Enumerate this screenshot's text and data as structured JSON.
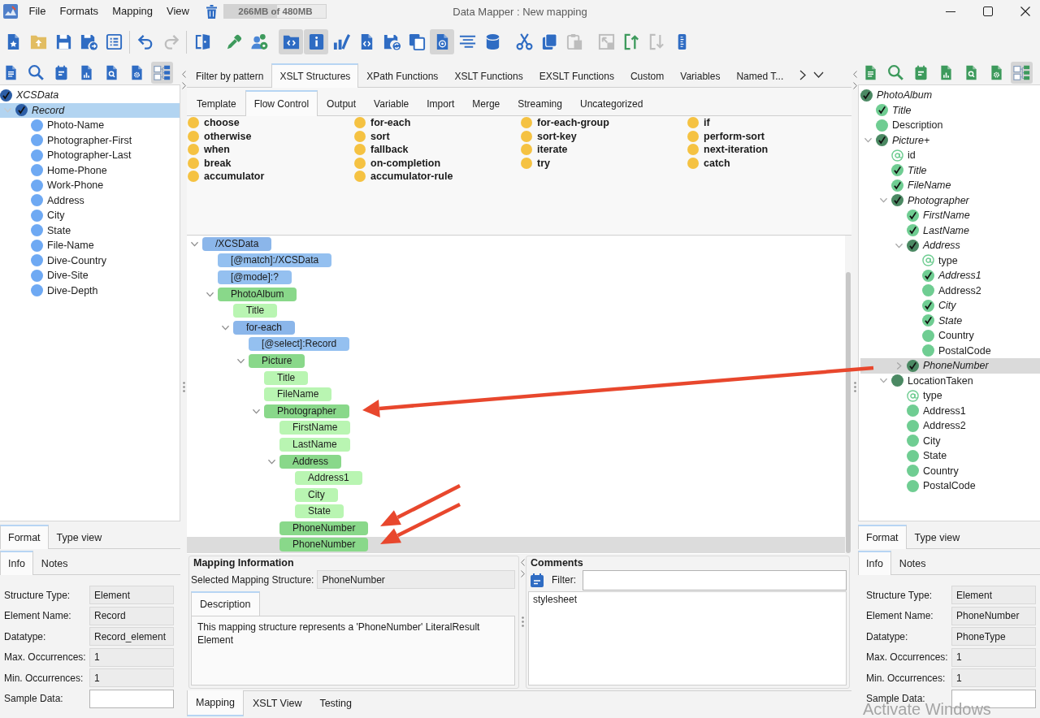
{
  "window": {
    "title": "Data Mapper : New mapping"
  },
  "menu": [
    "File",
    "Formats",
    "Mapping",
    "View"
  ],
  "memory": {
    "text": "266MB of 480MB",
    "level": 0.52
  },
  "toolbar": {
    "groups": [
      [
        {
          "pressed": false,
          "disabled": false
        },
        {
          "pressed": false,
          "disabled": false
        },
        {
          "pressed": false,
          "disabled": false
        },
        {
          "pressed": false,
          "disabled": false
        },
        {
          "pressed": false,
          "disabled": false
        }
      ],
      [
        {
          "pressed": false,
          "disabled": false
        },
        {
          "pressed": false,
          "disabled": true
        }
      ],
      [
        {
          "pressed": false,
          "disabled": false
        }
      ],
      [
        {
          "pressed": false,
          "disabled": false
        },
        {
          "pressed": false,
          "disabled": false
        }
      ],
      [
        {
          "pressed": true,
          "disabled": false
        },
        {
          "pressed": true,
          "disabled": false
        },
        {
          "pressed": false,
          "disabled": false
        },
        {
          "pressed": false,
          "disabled": false
        },
        {
          "pressed": false,
          "disabled": false
        },
        {
          "pressed": false,
          "disabled": false
        },
        {
          "pressed": true,
          "disabled": false
        },
        {
          "pressed": false,
          "disabled": false
        },
        {
          "pressed": false,
          "disabled": false
        }
      ],
      [
        {
          "pressed": false,
          "disabled": false
        },
        {
          "pressed": false,
          "disabled": false
        },
        {
          "pressed": false,
          "disabled": true
        }
      ],
      [
        {
          "pressed": false,
          "disabled": true
        },
        {
          "pressed": false,
          "disabled": false
        },
        {
          "pressed": false,
          "disabled": true
        },
        {
          "pressed": false,
          "disabled": false
        }
      ]
    ]
  },
  "source_panel": {
    "toolbar": [
      {
        "pressed": false
      },
      {
        "pressed": false
      },
      {
        "pressed": false
      },
      {
        "pressed": false
      },
      {
        "pressed": false
      },
      {
        "pressed": false
      },
      {
        "pressed": true
      }
    ],
    "tree": [
      {
        "label": "XCSData",
        "kind": "complex",
        "mapped": true,
        "selected": false,
        "children": [
          {
            "label": "Record",
            "kind": "complex",
            "mapped": true,
            "selected": true,
            "expanded": true,
            "children": [
              {
                "label": "Photo-Name",
                "kind": "simple",
                "mapped": false,
                "selected": false
              },
              {
                "label": "Photographer-First",
                "kind": "simple",
                "mapped": false,
                "selected": false
              },
              {
                "label": "Photographer-Last",
                "kind": "simple",
                "mapped": false,
                "selected": false
              },
              {
                "label": "Home-Phone",
                "kind": "simple",
                "mapped": false,
                "selected": false
              },
              {
                "label": "Work-Phone",
                "kind": "simple",
                "mapped": false,
                "selected": false
              },
              {
                "label": "Address",
                "kind": "simple",
                "mapped": false,
                "selected": false
              },
              {
                "label": "City",
                "kind": "simple",
                "mapped": false,
                "selected": false
              },
              {
                "label": "State",
                "kind": "simple",
                "mapped": false,
                "selected": false
              },
              {
                "label": "File-Name",
                "kind": "simple",
                "mapped": false,
                "selected": false
              },
              {
                "label": "Dive-Country",
                "kind": "simple",
                "mapped": false,
                "selected": false
              },
              {
                "label": "Dive-Site",
                "kind": "simple",
                "mapped": false,
                "selected": false
              },
              {
                "label": "Dive-Depth",
                "kind": "simple",
                "mapped": false,
                "selected": false
              }
            ]
          }
        ]
      }
    ],
    "view_tabs": [
      {
        "label": "Format",
        "selected": true
      },
      {
        "label": "Type view",
        "selected": false
      }
    ],
    "info_tabs": [
      {
        "label": "Info",
        "selected": true
      },
      {
        "label": "Notes",
        "selected": false
      }
    ],
    "properties": [
      {
        "label": "Structure Type:",
        "value": "Element",
        "editable": false
      },
      {
        "label": "Element Name:",
        "value": "Record",
        "editable": false
      },
      {
        "label": "Datatype:",
        "value": "Record_element",
        "editable": false
      },
      {
        "label": "Max. Occurrences:",
        "value": "1",
        "editable": false
      },
      {
        "label": "Min. Occurrences:",
        "value": "1",
        "editable": false
      },
      {
        "label": "Sample Data:",
        "editable": true
      }
    ]
  },
  "center": {
    "tabs": [
      {
        "label": "Filter by pattern",
        "selected": false
      },
      {
        "label": "XSLT Structures",
        "selected": true
      },
      {
        "label": "XPath Functions",
        "selected": false
      },
      {
        "label": "XSLT Functions",
        "selected": false
      },
      {
        "label": "EXSLT Functions",
        "selected": false
      },
      {
        "label": "Custom",
        "selected": false
      },
      {
        "label": "Variables",
        "selected": false
      },
      {
        "label": "Named T...",
        "selected": false
      }
    ],
    "subtabs": [
      {
        "label": "Template",
        "selected": false
      },
      {
        "label": "Flow Control",
        "selected": true
      },
      {
        "label": "Output",
        "selected": false
      },
      {
        "label": "Variable",
        "selected": false
      },
      {
        "label": "Import",
        "selected": false
      },
      {
        "label": "Merge",
        "selected": false
      },
      {
        "label": "Streaming",
        "selected": false
      },
      {
        "label": "Uncategorized",
        "selected": false
      }
    ],
    "palette": [
      "choose",
      "for-each",
      "for-each-group",
      "if",
      "otherwise",
      "sort",
      "sort-key",
      "perform-sort",
      "when",
      "fallback",
      "iterate",
      "next-iteration",
      "break",
      "on-completion",
      "try",
      "catch",
      "accumulator",
      "accumulator-rule"
    ],
    "mapping_tree": [
      {
        "label": "/XCSData",
        "kind": "instruction",
        "selected": false,
        "expanded": true,
        "children": [
          {
            "label": "[@match]:/XCSData",
            "kind": "attribute",
            "selected": false
          },
          {
            "label": "[@mode]:?",
            "kind": "attribute",
            "selected": false
          },
          {
            "label": "PhotoAlbum",
            "kind": "element",
            "selected": false,
            "expanded": true,
            "children": [
              {
                "label": "Title",
                "kind": "leaf",
                "selected": false
              },
              {
                "label": "for-each",
                "kind": "instruction",
                "selected": false,
                "expanded": true,
                "children": [
                  {
                    "label": "[@select]:Record",
                    "kind": "attribute",
                    "selected": false
                  },
                  {
                    "label": "Picture",
                    "kind": "element",
                    "selected": false,
                    "expanded": true,
                    "children": [
                      {
                        "label": "Title",
                        "kind": "leaf",
                        "selected": false
                      },
                      {
                        "label": "FileName",
                        "kind": "leaf",
                        "selected": false
                      },
                      {
                        "label": "Photographer",
                        "kind": "element",
                        "selected": false,
                        "expanded": true,
                        "children": [
                          {
                            "label": "FirstName",
                            "kind": "leaf",
                            "selected": false
                          },
                          {
                            "label": "LastName",
                            "kind": "leaf",
                            "selected": false
                          },
                          {
                            "label": "Address",
                            "kind": "element",
                            "selected": false,
                            "expanded": true,
                            "children": [
                              {
                                "label": "Address1",
                                "kind": "leaf",
                                "selected": false
                              },
                              {
                                "label": "City",
                                "kind": "leaf",
                                "selected": false
                              },
                              {
                                "label": "State",
                                "kind": "leaf",
                                "selected": false
                              }
                            ]
                          },
                          {
                            "label": "PhoneNumber",
                            "kind": "element",
                            "selected": false
                          },
                          {
                            "label": "PhoneNumber",
                            "kind": "element",
                            "selected": true
                          }
                        ]
                      }
                    ]
                  }
                ]
              }
            ]
          }
        ]
      }
    ],
    "mapping_info": {
      "title": "Mapping Information",
      "structure_label": "Selected Mapping Structure:",
      "structure_value": "PhoneNumber",
      "tabs": [
        {
          "label": "Description",
          "selected": true
        }
      ],
      "description": "This mapping structure represents a 'PhoneNumber' LiteralResult Element"
    },
    "comments": {
      "title": "Comments",
      "filter_label": "Filter:",
      "text": "stylesheet"
    },
    "bottom_tabs": [
      {
        "label": "Mapping",
        "selected": true
      },
      {
        "label": "XSLT View",
        "selected": false
      },
      {
        "label": "Testing",
        "selected": false
      }
    ]
  },
  "target_panel": {
    "toolbar": [
      {
        "pressed": false
      },
      {
        "pressed": false
      },
      {
        "pressed": false
      },
      {
        "pressed": false
      },
      {
        "pressed": false
      },
      {
        "pressed": false
      },
      {
        "pressed": true
      }
    ],
    "tree": [
      {
        "label": "PhotoAlbum",
        "kind": "complex",
        "mapped": true,
        "selected": false,
        "children": [
          {
            "label": "Title",
            "kind": "simple",
            "mapped": true,
            "selected": false
          },
          {
            "label": "Description",
            "kind": "simple",
            "mapped": false,
            "selected": false
          },
          {
            "label": "Picture+",
            "kind": "complex",
            "mapped": true,
            "selected": false,
            "expanded": true,
            "children": [
              {
                "label": "id",
                "kind": "attribute",
                "mapped": false,
                "selected": false
              },
              {
                "label": "Title",
                "kind": "simple",
                "mapped": true,
                "selected": false
              },
              {
                "label": "FileName",
                "kind": "simple",
                "mapped": true,
                "selected": false
              },
              {
                "label": "Photographer",
                "kind": "complex",
                "mapped": true,
                "selected": false,
                "expanded": true,
                "children": [
                  {
                    "label": "FirstName",
                    "kind": "simple",
                    "mapped": true,
                    "selected": false
                  },
                  {
                    "label": "LastName",
                    "kind": "simple",
                    "mapped": true,
                    "selected": false
                  },
                  {
                    "label": "Address",
                    "kind": "complex",
                    "mapped": true,
                    "selected": false,
                    "expanded": true,
                    "children": [
                      {
                        "label": "type",
                        "kind": "attribute",
                        "mapped": false,
                        "selected": false
                      },
                      {
                        "label": "Address1",
                        "kind": "simple",
                        "mapped": true,
                        "selected": false
                      },
                      {
                        "label": "Address2",
                        "kind": "simple",
                        "mapped": false,
                        "selected": false
                      },
                      {
                        "label": "City",
                        "kind": "simple",
                        "mapped": true,
                        "selected": false
                      },
                      {
                        "label": "State",
                        "kind": "simple",
                        "mapped": true,
                        "selected": false
                      },
                      {
                        "label": "Country",
                        "kind": "simple",
                        "mapped": false,
                        "selected": false
                      },
                      {
                        "label": "PostalCode",
                        "kind": "simple",
                        "mapped": false,
                        "selected": false
                      }
                    ]
                  },
                  {
                    "label": "PhoneNumber",
                    "kind": "complex",
                    "mapped": true,
                    "selected": true,
                    "expanded": false
                  }
                ]
              },
              {
                "label": "LocationTaken",
                "kind": "complex",
                "mapped": false,
                "selected": false,
                "expanded": true,
                "children": [
                  {
                    "label": "type",
                    "kind": "attribute",
                    "mapped": false,
                    "selected": false
                  },
                  {
                    "label": "Address1",
                    "kind": "simple",
                    "mapped": false,
                    "selected": false
                  },
                  {
                    "label": "Address2",
                    "kind": "simple",
                    "mapped": false,
                    "selected": false
                  },
                  {
                    "label": "City",
                    "kind": "simple",
                    "mapped": false,
                    "selected": false
                  },
                  {
                    "label": "State",
                    "kind": "simple",
                    "mapped": false,
                    "selected": false
                  },
                  {
                    "label": "Country",
                    "kind": "simple",
                    "mapped": false,
                    "selected": false
                  },
                  {
                    "label": "PostalCode",
                    "kind": "simple",
                    "mapped": false,
                    "selected": false
                  }
                ]
              }
            ]
          }
        ]
      }
    ],
    "view_tabs": [
      {
        "label": "Format",
        "selected": true
      },
      {
        "label": "Type view",
        "selected": false
      }
    ],
    "info_tabs": [
      {
        "label": "Info",
        "selected": true
      },
      {
        "label": "Notes",
        "selected": false
      }
    ],
    "properties": [
      {
        "label": "Structure Type:",
        "value": "Element",
        "editable": false
      },
      {
        "label": "Element Name:",
        "value": "PhoneNumber",
        "editable": false
      },
      {
        "label": "Datatype:",
        "value": "PhoneType",
        "editable": false
      },
      {
        "label": "Max. Occurrences:",
        "value": "1",
        "editable": false
      },
      {
        "label": "Min. Occurrences:",
        "value": "1",
        "editable": false
      },
      {
        "label": "Sample Data:",
        "editable": true
      }
    ]
  },
  "os_notice": {
    "text": "Activate Windows"
  }
}
